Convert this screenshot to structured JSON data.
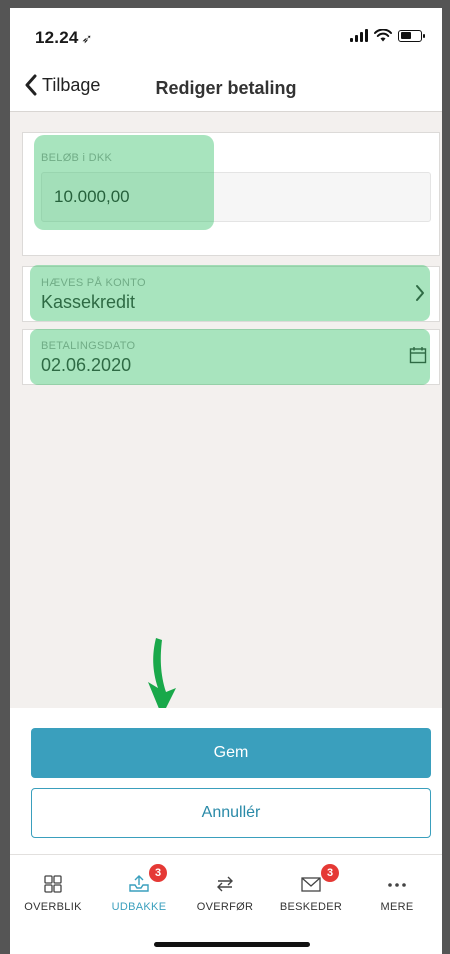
{
  "status_bar": {
    "time": "12.24",
    "location_glyph": "➶"
  },
  "nav": {
    "back_label": "Tilbage",
    "title": "Rediger betaling"
  },
  "amount": {
    "label": "BELØB i DKK",
    "value": "10.000,00"
  },
  "account": {
    "label": "HÆVES PÅ KONTO",
    "value": "Kassekredit"
  },
  "date": {
    "label": "BETALINGSDATO",
    "value": "02.06.2020"
  },
  "actions": {
    "save_label": "Gem",
    "cancel_label": "Annullér"
  },
  "tabs": [
    {
      "label": "OVERBLIK",
      "icon": "grid-icon",
      "badge": null
    },
    {
      "label": "UDBAKKE",
      "icon": "outbox-icon",
      "badge": "3"
    },
    {
      "label": "OVERFØR",
      "icon": "transfer-icon",
      "badge": null
    },
    {
      "label": "BESKEDER",
      "icon": "mail-icon",
      "badge": "3"
    },
    {
      "label": "MERE",
      "icon": "more-icon",
      "badge": null
    }
  ],
  "colors": {
    "accent": "#3a9fbd",
    "badge": "#e53935",
    "highlight": "#3fc46e"
  }
}
